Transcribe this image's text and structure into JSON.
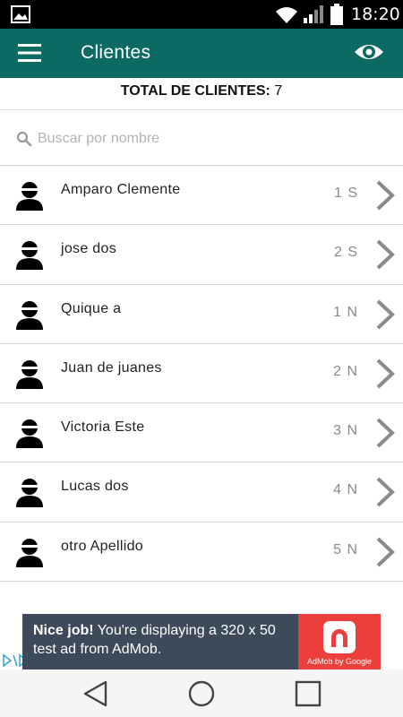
{
  "status_bar": {
    "time": "18:20",
    "icons": [
      "gallery-icon",
      "wifi-icon",
      "signal-icon",
      "battery-icon"
    ]
  },
  "app_bar": {
    "title": "Clientes",
    "menu_icon": "hamburger-icon",
    "action_icon": "eye-icon",
    "color": "#0b6b63"
  },
  "total": {
    "label": "TOTAL DE CLIENTES:",
    "value": "7"
  },
  "search": {
    "placeholder": "Buscar por nombre",
    "value": ""
  },
  "clients": [
    {
      "name": "Amparo Clemente",
      "count": "1 S"
    },
    {
      "name": "jose dos",
      "count": "2 S"
    },
    {
      "name": "Quique a",
      "count": "1 N"
    },
    {
      "name": "Juan de juanes",
      "count": "2 N"
    },
    {
      "name": "Victoria Este",
      "count": "3 N"
    },
    {
      "name": "Lucas dos",
      "count": "4 N"
    },
    {
      "name": "otro Apellido",
      "count": "5 N"
    }
  ],
  "ad": {
    "headline": "Nice job!",
    "body": "You're displaying a 320 x 50 test ad from AdMob.",
    "brand": "AdMob by Google",
    "bg_color": "#3c4a5a",
    "logo_color": "#ec3f3b"
  },
  "nav_bar": {
    "icons": [
      "back-icon",
      "home-icon",
      "recents-icon"
    ]
  }
}
